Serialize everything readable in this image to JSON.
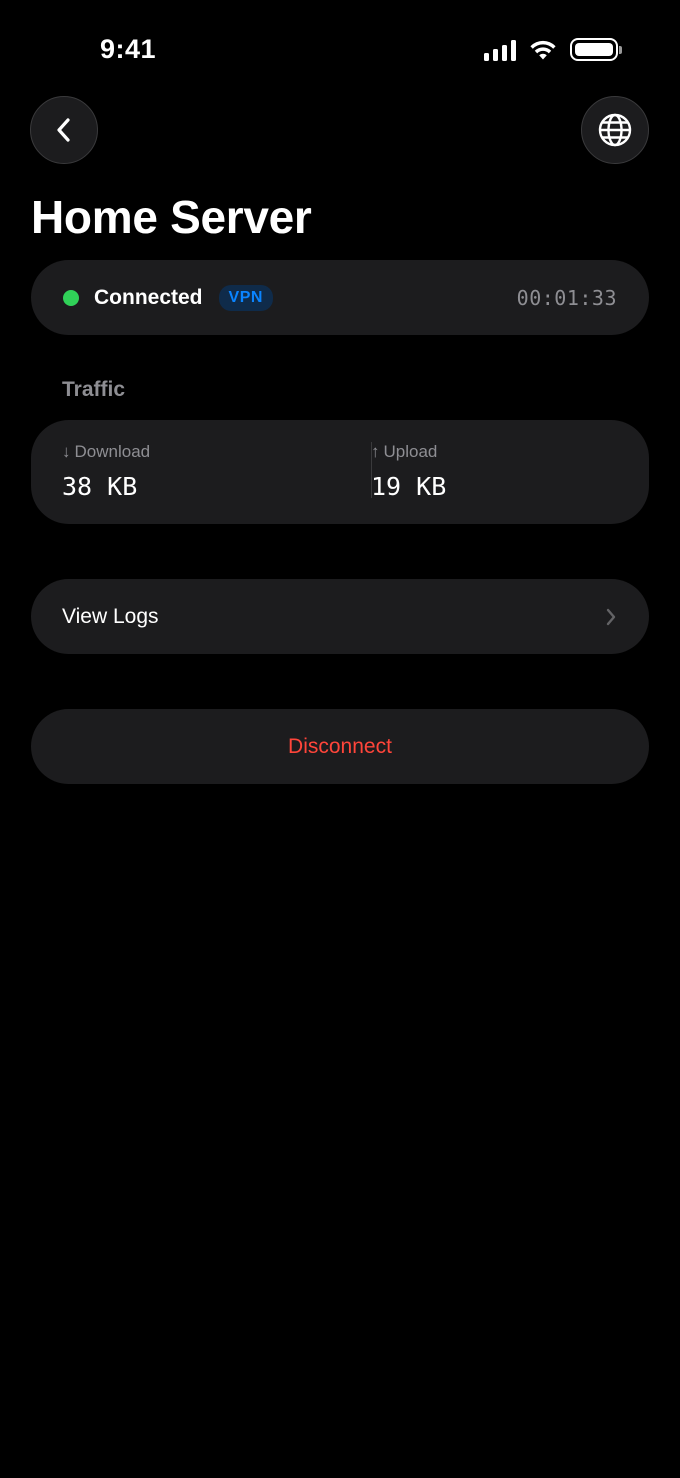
{
  "status_bar": {
    "time": "9:41"
  },
  "nav": {
    "back_icon": "chevron-left-icon",
    "globe_icon": "globe-icon"
  },
  "page": {
    "title": "Home Server"
  },
  "connection": {
    "status": "Connected",
    "badge": "VPN",
    "elapsed": "00:01:33",
    "status_color": "#30d158",
    "badge_color": "#0a84ff"
  },
  "traffic": {
    "section_title": "Traffic",
    "download": {
      "arrow": "↓",
      "label": "Download",
      "value": "38 KB"
    },
    "upload": {
      "arrow": "↑",
      "label": "Upload",
      "value": "19 KB"
    }
  },
  "actions": {
    "view_logs": "View Logs",
    "disconnect": "Disconnect",
    "disconnect_color": "#ff453a"
  }
}
